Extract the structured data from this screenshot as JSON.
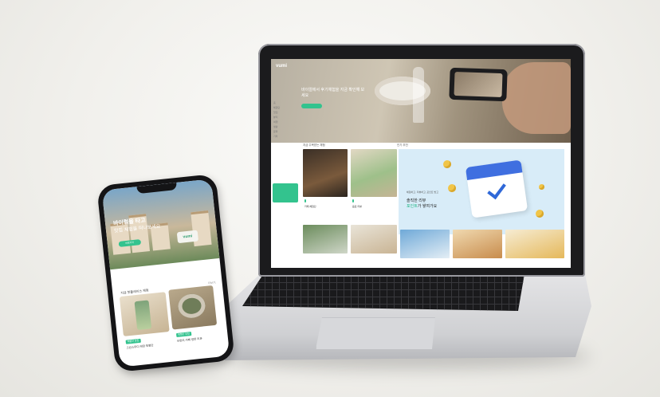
{
  "scene": "device-mockup",
  "colors": {
    "brand_green": "#33c38e",
    "accent_blue": "#3f6fe0"
  },
  "laptop": {
    "site_logo": "vumi",
    "hero_title": "바이럴에서 후기체험을 지금 확인해 보세요",
    "sidebar_items": [
      "홈",
      "체험단",
      "맛집",
      "뷰티",
      "여행",
      "생활",
      "문화",
      "기타"
    ],
    "section_left": "지금 주목받는 체험",
    "section_right": "인기 추천",
    "tile_captions": [
      "카페 체험단",
      "음료 리뷰"
    ],
    "banner": {
      "small": "체험하고, 리뷰하고, 포인트 받고",
      "line1": "솔직한 리뷰",
      "line2_accent": "포인트",
      "line2_rest": "가 쌓여가요"
    }
  },
  "phone": {
    "sign": "vumi",
    "hero_title": "바이럴을 타고",
    "hero_sub": "맛집 체험을 떠나보세요",
    "hero_button": "바로가기",
    "section_title": "지금 핫플레이스 체험",
    "more": "더보기",
    "tag": "체험단 모집",
    "card_captions": [
      "그린스무디 매장 체험단",
      "브런치 카페 방문 리뷰"
    ]
  }
}
